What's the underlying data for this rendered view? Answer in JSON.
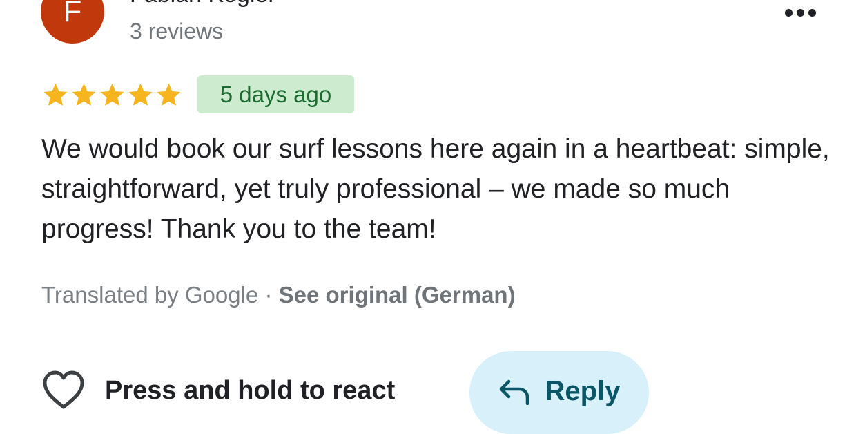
{
  "reviewer": {
    "avatar_letter": "F",
    "avatar_color": "#c1380c",
    "name": "Fabian Kogler",
    "review_count": "3 reviews"
  },
  "menu": {
    "icon": "more-horizontal-icon"
  },
  "rating": {
    "stars": 5,
    "max_stars": 5,
    "star_color": "#f6b51e"
  },
  "date_badge": {
    "text": "5 days ago",
    "background": "#cdeccf",
    "text_color": "#1e6b32"
  },
  "review": {
    "text": "We would book our surf lessons here again in a heartbeat: simple, straightforward, yet truly professional – we made so much progress! Thank you to the team!"
  },
  "translation": {
    "label": "Translated by Google",
    "separator": "·",
    "see_original": "See original (German)"
  },
  "actions": {
    "react_label": "Press and hold to react",
    "react_icon": "heart-icon",
    "reply_label": "Reply",
    "reply_icon": "reply-arrow-icon",
    "reply_background": "#d7f0fa"
  }
}
